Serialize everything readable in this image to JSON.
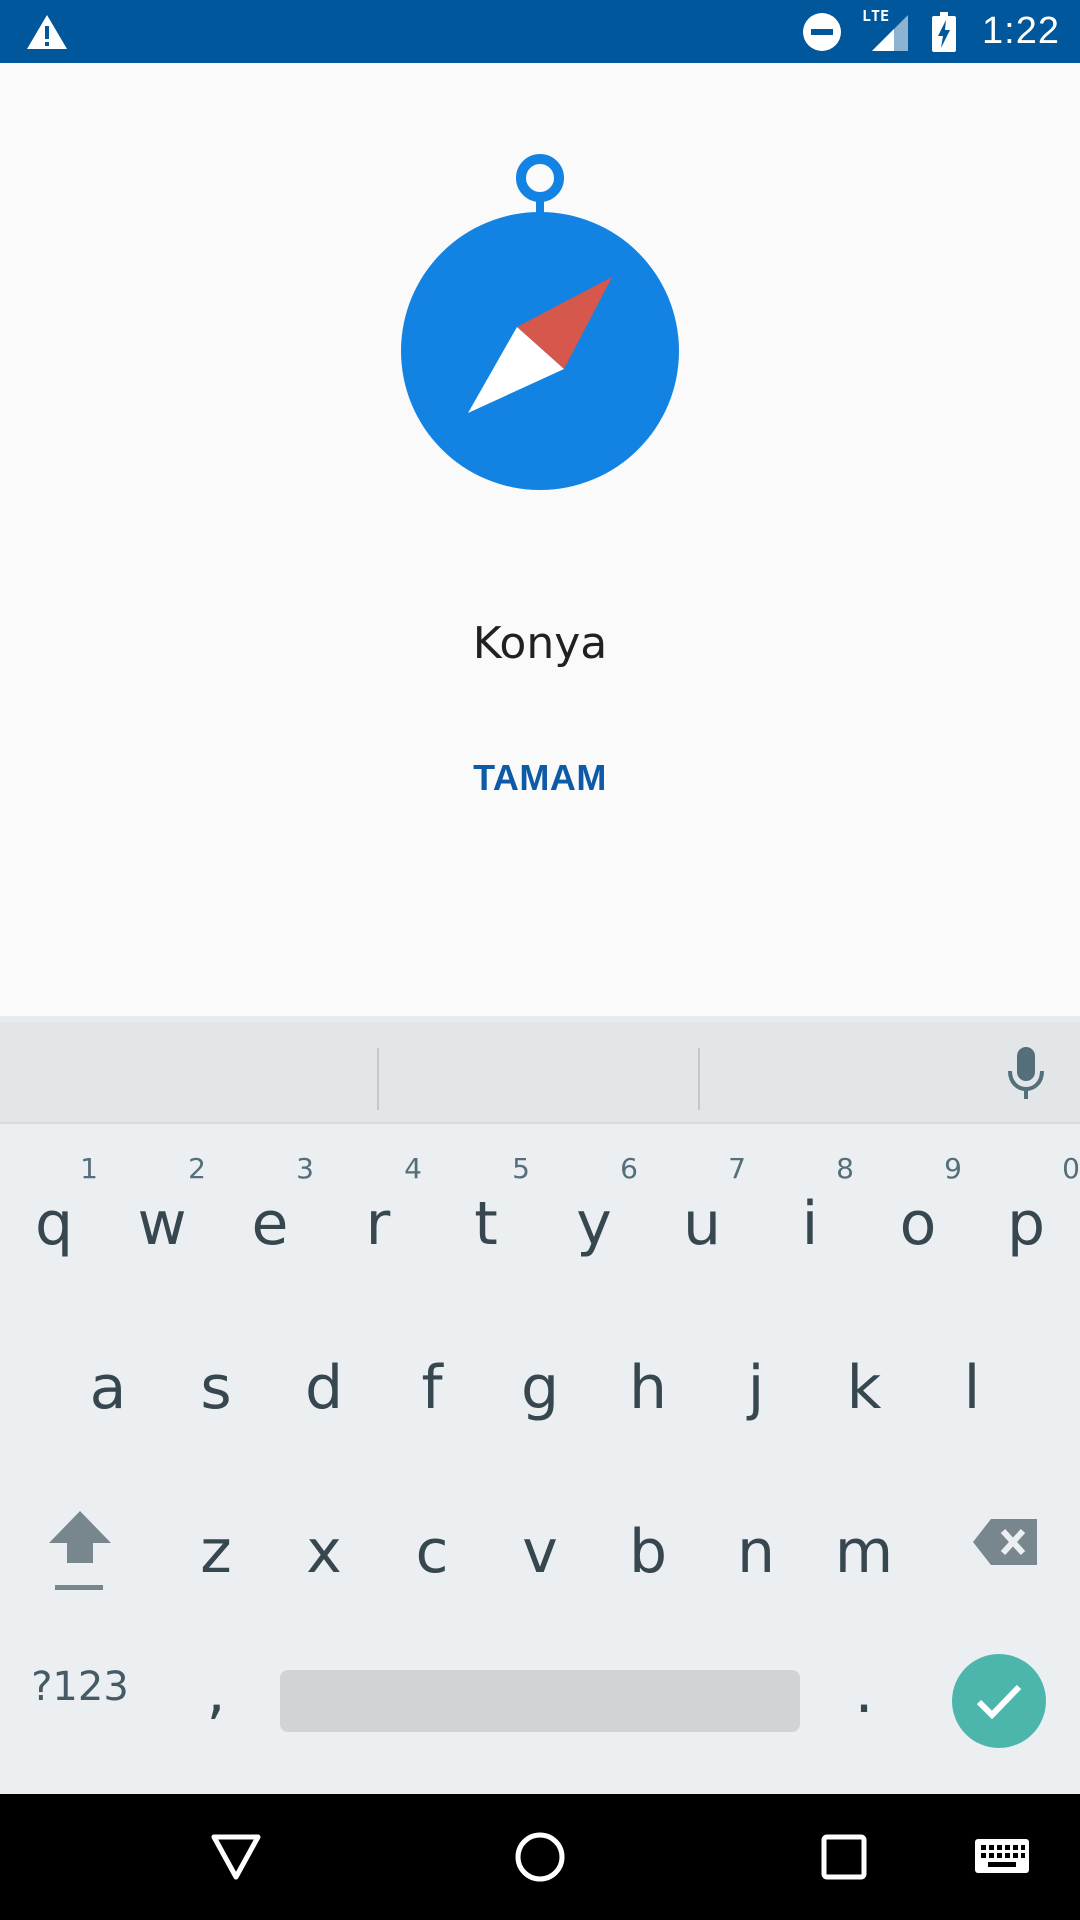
{
  "status_bar": {
    "time": "1:22",
    "network": "LTE",
    "icons": [
      "warning-icon",
      "do-not-disturb-icon",
      "lte-signal-icon",
      "battery-charging-icon"
    ]
  },
  "dialog": {
    "city": "Konya",
    "ok_label": "TAMAM",
    "logo": "compass-icon",
    "accent_color": "#1283e3",
    "needle_color": "#d6574b",
    "button_color": "#0d5aa7"
  },
  "keyboard": {
    "suggestions": [
      "",
      "",
      ""
    ],
    "row1": [
      {
        "letter": "q",
        "hint": "1"
      },
      {
        "letter": "w",
        "hint": "2"
      },
      {
        "letter": "e",
        "hint": "3"
      },
      {
        "letter": "r",
        "hint": "4"
      },
      {
        "letter": "t",
        "hint": "5"
      },
      {
        "letter": "y",
        "hint": "6"
      },
      {
        "letter": "u",
        "hint": "7"
      },
      {
        "letter": "i",
        "hint": "8"
      },
      {
        "letter": "o",
        "hint": "9"
      },
      {
        "letter": "p",
        "hint": "0"
      }
    ],
    "row2": [
      "a",
      "s",
      "d",
      "f",
      "g",
      "h",
      "j",
      "k",
      "l"
    ],
    "row3": [
      "z",
      "x",
      "c",
      "v",
      "b",
      "n",
      "m"
    ],
    "symbols_label": "?123",
    "comma_label": ",",
    "period_label": ".",
    "enter_color": "#4db6ac"
  },
  "nav_bar": {
    "buttons": [
      "back-icon",
      "home-icon",
      "recents-icon",
      "keyboard-switch-icon"
    ]
  }
}
